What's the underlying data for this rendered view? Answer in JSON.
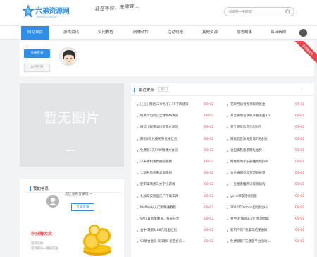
{
  "header": {
    "logo_text": "六弟资源网",
    "logo_sub": "www.6dzy.com",
    "slogan": "我在等你，无需等…",
    "search_placeholder": "找东西一搜即可！"
  },
  "nav": {
    "items": [
      {
        "label": "网站首页",
        "active": true
      },
      {
        "label": "游戏资讯",
        "active": false
      },
      {
        "label": "实用教程",
        "active": false
      },
      {
        "label": "网赚软件",
        "active": false
      },
      {
        "label": "活动线报",
        "active": false
      },
      {
        "label": "其他资源",
        "active": false
      },
      {
        "label": "励志故事",
        "active": false
      },
      {
        "label": "每日新闻",
        "active": false
      }
    ]
  },
  "user_card": {
    "login_label": "注册登录",
    "register_label": "本月签到",
    "ribbon": "签到赚金币"
  },
  "placeholder": {
    "text": "暂无图片"
  },
  "my_info": {
    "title": "我的信息",
    "not_logged": "您还没有登录哦～",
    "login_now": "立即登录",
    "checkin_title": "积分赚大奖",
    "checkin_desc_1": "签到兑换",
    "checkin_desc_2": "签到积分一换越签越"
  },
  "updates": {
    "title": "最近更新",
    "badge": "97",
    "left": [
      {
        "tag": "广告",
        "title": "网站SEO优化7-15下快速排…",
        "date": "09-02"
      },
      {
        "title": "好莱坞电影在全球热映演员",
        "date": "09-02"
      },
      {
        "title": "微信小程序404页面从源码",
        "date": "09-02"
      },
      {
        "title": "腾讯3元兑换奖券兑换红包",
        "date": "09-02"
      },
      {
        "title": "免费领3天SVIP微博大会员",
        "date": "09-02"
      },
      {
        "title": "小米手机免费抽取视频",
        "date": "09-02"
      },
      {
        "title": "全国各地迎来高温降雨",
        "date": "09-02"
      },
      {
        "title": "使审美情感与文学小游戏",
        "date": "09-02"
      },
      {
        "title": "扎加双实测国庆户下载工具",
        "date": "09-02"
      },
      {
        "title": "Mafiab从入门到精通教程",
        "date": "09-02"
      },
      {
        "title": "9月1日新增球员，每天分享",
        "date": "09-02"
      },
      {
        "title": "会中 最新1.68元现金红包",
        "date": "09-02"
      },
      {
        "title": "91联合会员 买1赠8 秘密会员…",
        "date": "09-02"
      }
    ],
    "right": [
      {
        "title": "花呗月初领券领取到帐金",
        "date": "09-02"
      },
      {
        "title": "某音表情包领取来看美国3.5",
        "date": "09-02"
      },
      {
        "title": "某宝现有信息代付2折",
        "date": "09-02"
      },
      {
        "title": "网易云音乐免费领7天会员",
        "date": "09-02"
      },
      {
        "title": "全国高铁路系网址抽奖",
        "date": "09-02"
      },
      {
        "title": "网易新闻学乐部抽奖加Jom",
        "date": "09-02"
      },
      {
        "title": "会举报网页三方游戏推荐",
        "date": "09-02"
      },
      {
        "title": "一张图看懂腾讯股权结构",
        "date": "09-02"
      },
      {
        "title": "yoyo领取活动链接",
        "date": "09-02"
      },
      {
        "title": "2020年Python自动化办公",
        "date": "09-02"
      },
      {
        "title": "会中 赶快领2.5元 移动领取",
        "date": "09-02"
      },
      {
        "title": "新用户领7天集马结果通知",
        "date": "09-02"
      },
      {
        "title": "免费领取7天播放平台活动…",
        "date": "09-02"
      }
    ]
  },
  "colors": {
    "accent": "#2e8ee8",
    "date": "#e8474b"
  }
}
